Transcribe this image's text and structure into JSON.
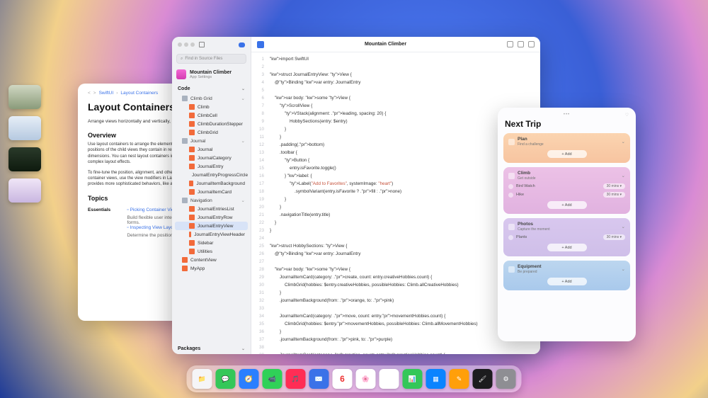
{
  "stage": [
    {
      "name": "outdoor-living",
      "cls": "a"
    },
    {
      "name": "safari-window",
      "cls": "b"
    },
    {
      "name": "day3-fitness",
      "cls": "c"
    },
    {
      "name": "notes-app",
      "cls": "d"
    }
  ],
  "doc": {
    "crumbs": [
      "<",
      ">",
      "SwiftUI",
      "Layout Containers"
    ],
    "title": "Layout Containers",
    "desc": "Arrange views horizontally and vertically, and group views into lists and grids.",
    "overview_h": "Overview",
    "overview_p1": "Use layout containers to arrange the elements of your user interface and adjust the positions of the child views they contain in response to changes in content or interface dimensions. You can nest layout containers inside other layout containers to achieve complex layout effects.",
    "overview_p2": "To fine-tune the position, alignment, and other elements of a layout that you build with container views, use the view modifiers in Layout Adjustments. A Layout type also provides more sophisticated behaviors, like a lot more control.",
    "topics_h": "Topics",
    "essentials_label": "Essentials",
    "essentials_links": [
      {
        "title": "Picking Container Views for Your Content",
        "sub": "Build flexible user interfaces by using stacks, grids, lists, and forms."
      },
      {
        "title": "Inspecting View Layout",
        "sub": "Determine the position and extent of a view."
      }
    ]
  },
  "xcode": {
    "search_placeholder": "Find in Source Files",
    "app_name": "Mountain Climber",
    "app_sub": "App Settings",
    "toolbar_title": "Mountain Climber",
    "sections": {
      "code": "Code",
      "packages": "Packages"
    },
    "tree": [
      {
        "type": "folder",
        "label": "Climb Grid"
      },
      {
        "type": "swift",
        "label": "Climb",
        "nested": true
      },
      {
        "type": "swift",
        "label": "ClimbCell",
        "nested": true
      },
      {
        "type": "swift",
        "label": "ClimbDurationStepper",
        "nested": true
      },
      {
        "type": "swift",
        "label": "ClimbGrid",
        "nested": true
      },
      {
        "type": "folder",
        "label": "Journal"
      },
      {
        "type": "swift",
        "label": "Journal",
        "nested": true
      },
      {
        "type": "swift",
        "label": "JournalCategory",
        "nested": true
      },
      {
        "type": "swift",
        "label": "JournalEntry",
        "nested": true
      },
      {
        "type": "swift",
        "label": "JournalEntryProgressCircle",
        "nested": true
      },
      {
        "type": "swift",
        "label": "JournalItemBackground",
        "nested": true
      },
      {
        "type": "swift",
        "label": "JournalItemCard",
        "nested": true
      },
      {
        "type": "folder",
        "label": "Navigation"
      },
      {
        "type": "swift",
        "label": "JournalEntriesList",
        "nested": true
      },
      {
        "type": "swift",
        "label": "JournalEntryRow",
        "nested": true
      },
      {
        "type": "swift",
        "label": "JournalEntryView",
        "nested": true,
        "selected": true
      },
      {
        "type": "swift",
        "label": "JournalEntryViewHeader",
        "nested": true
      },
      {
        "type": "swift",
        "label": "Sidebar",
        "nested": true
      },
      {
        "type": "swift",
        "label": "Utilities",
        "nested": true
      },
      {
        "type": "swift",
        "label": "ContentView"
      },
      {
        "type": "swift",
        "label": "MyApp"
      }
    ],
    "code_lines": [
      "import SwiftUI",
      "",
      "struct JournalEntryView: View {",
      "    @Binding var entry: JournalEntry",
      "",
      "    var body: some View {",
      "        ScrollView {",
      "            VStack(alignment: .leading, spacing: 20) {",
      "                HobbySections(entry: $entry)",
      "            }",
      "        }",
      "        .padding(.bottom)",
      "        .toolbar {",
      "            Button {",
      "                entry.isFavorite.toggle()",
      "            } label: {",
      "                Label(\"Add to Favorites\", systemImage: \"heart\")",
      "                    .symbolVariant(entry.isFavorite ? .fill : .none)",
      "            }",
      "        }",
      "        .navigationTitle(entry.title)",
      "    }",
      "}",
      "",
      "struct HobbySections: View {",
      "    @Binding var entry: JournalEntry",
      "",
      "    var body: some View {",
      "        JournalItemCard(category: .create, count: entry.creativeHobbies.count) {",
      "            ClimbGrid(hobbies: $entry.creativeHobbies, possibleHobbies: Climb.allCreativeHobbies)",
      "        }",
      "        .journalItemBackground(from: .orange, to: .pink)",
      "",
      "        JournalItemCard(category: .move, count: entry.movementHobbies.count) {",
      "            ClimbGrid(hobbies: $entry.movementHobbies, possibleHobbies: Climb.allMovementHobbies)",
      "        }",
      "        .journalItemBackground(from: .pink, to: .purple)",
      "",
      "        JournalItemCard(category: .practice, count: entry.practiceHobbies.count) {"
    ]
  },
  "preview": {
    "title": "Next Trip",
    "cards": [
      {
        "cls": "plan",
        "icon": "clipboard-icon",
        "title": "Plan",
        "sub": "Find a challenge",
        "add": "+  Add",
        "rows": []
      },
      {
        "cls": "climb",
        "icon": "mountain-icon",
        "title": "Climb",
        "sub": "Get outside",
        "add": "+  Add",
        "rows": [
          {
            "icon": "bird-icon",
            "label": "Bird Watch",
            "badge": "30 mins ▾"
          },
          {
            "icon": "hike-icon",
            "label": "Hike",
            "badge": "30 mins ▾"
          }
        ]
      },
      {
        "cls": "photos",
        "icon": "camera-icon",
        "title": "Photos",
        "sub": "Capture the moment",
        "add": "+  Add",
        "rows": [
          {
            "icon": "leaf-icon",
            "label": "Plants",
            "badge": "30 mins ▾"
          }
        ]
      },
      {
        "cls": "equip",
        "icon": "backpack-icon",
        "title": "Equipment",
        "sub": "Be prepared",
        "add": "+  Add",
        "rows": []
      }
    ]
  },
  "dock": [
    {
      "name": "files",
      "bg": "#f5f5f7",
      "glyph": "📁"
    },
    {
      "name": "messages",
      "bg": "#34c759",
      "glyph": "💬"
    },
    {
      "name": "safari",
      "bg": "#2a7fff",
      "glyph": "🧭"
    },
    {
      "name": "facetime",
      "bg": "#30d158",
      "glyph": "📹"
    },
    {
      "name": "music",
      "bg": "#ff2d55",
      "glyph": "🎵"
    },
    {
      "name": "mail",
      "bg": "#3a72e8",
      "glyph": "✉️"
    },
    {
      "name": "calendar",
      "bg": "#ffffff",
      "glyph": "6"
    },
    {
      "name": "photos",
      "bg": "#ffffff",
      "glyph": "🌸"
    },
    {
      "name": "reminders",
      "bg": "#ffffff",
      "glyph": "≣"
    },
    {
      "name": "numbers",
      "bg": "#34c759",
      "glyph": "📊"
    },
    {
      "name": "keynote",
      "bg": "#0a84ff",
      "glyph": "▦"
    },
    {
      "name": "pages",
      "bg": "#ff9f0a",
      "glyph": "✎"
    },
    {
      "name": "procreate",
      "bg": "#1c1c1e",
      "glyph": "🖌"
    },
    {
      "name": "settings",
      "bg": "#8e8e93",
      "glyph": "⚙"
    }
  ]
}
